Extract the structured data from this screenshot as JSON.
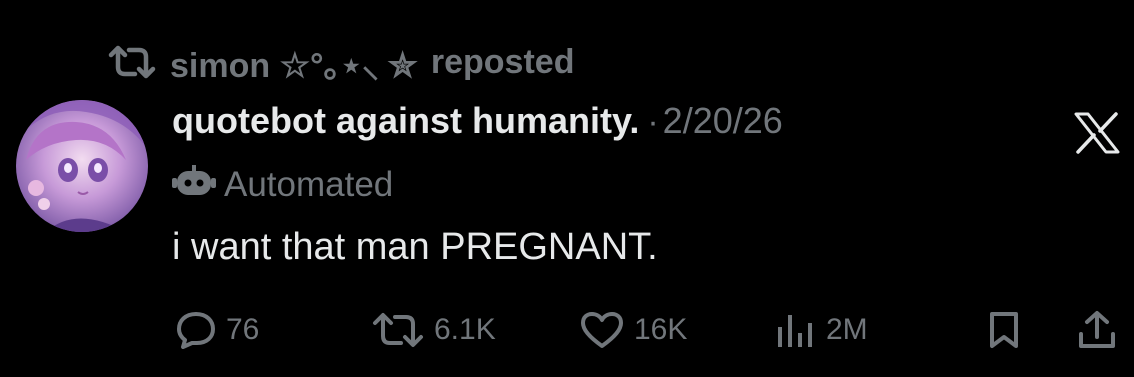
{
  "repost": {
    "user": "simon ☆°｡⋆⸜ ✮",
    "label": "reposted",
    "icon": "repost-icon"
  },
  "tweet": {
    "display_name": "quotebot against humanity.",
    "separator": "·",
    "date": "2/20/26",
    "automated_label": "Automated",
    "text": "i want that man PREGNANT.",
    "platform_logo": "x-logo"
  },
  "actions": {
    "replies": "76",
    "reposts": "6.1K",
    "likes": "16K",
    "views": "2M",
    "icons": [
      "reply-icon",
      "repost-icon",
      "like-icon",
      "views-icon",
      "bookmark-icon",
      "share-icon"
    ]
  },
  "colors": {
    "background": "#000000",
    "text": "#e7e9ea",
    "muted": "#71767b"
  }
}
